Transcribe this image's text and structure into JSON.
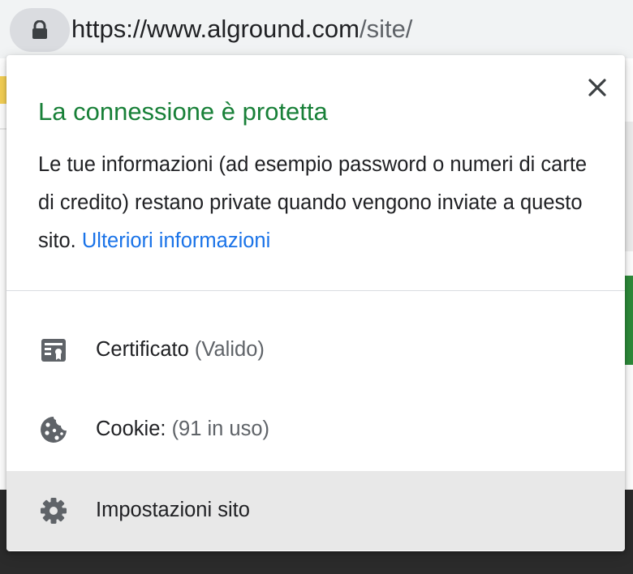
{
  "browser": {
    "url_main": "https://www.alground.com",
    "url_path": "/site/",
    "lock_icon": "lock-icon"
  },
  "popup": {
    "title": "La connessione è protetta",
    "description": "Le tue informazioni (ad esempio password o numeri di carte di credito) restano private quando vengono inviate a questo sito.",
    "learn_more": "Ulteriori informazioni",
    "close_icon": "close-icon",
    "items": [
      {
        "label": "Certificato",
        "detail": "(Valido)",
        "icon": "certificate-icon"
      },
      {
        "label": "Cookie:",
        "detail": "(91 in uso)",
        "icon": "cookie-icon"
      },
      {
        "label": "Impostazioni sito",
        "detail": "",
        "icon": "gear-icon"
      }
    ]
  },
  "colors": {
    "title_green": "#188038",
    "link_blue": "#1a73e8",
    "text": "#202124",
    "secondary_text": "#5f6368",
    "hover_row": "#e8e8e8"
  }
}
